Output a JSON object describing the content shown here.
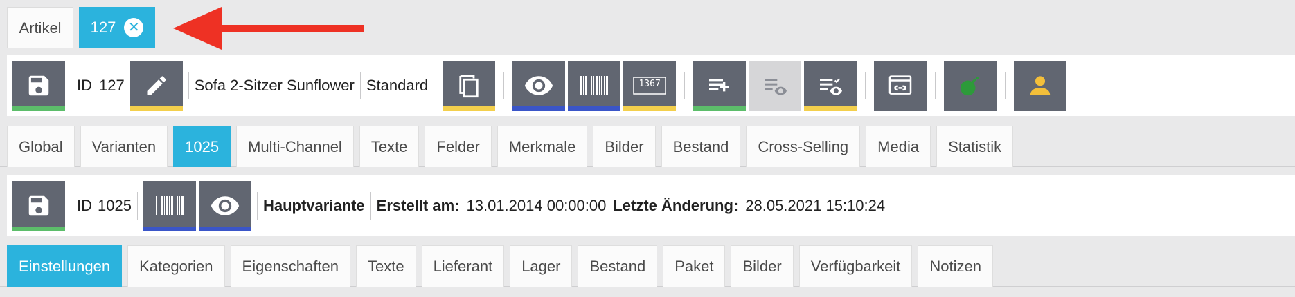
{
  "top_tabs": {
    "artikel": "Artikel",
    "active": "127"
  },
  "toolbar1": {
    "id_label": "ID",
    "id_value": "127",
    "name": "Sofa 2-Sitzer Sunflower",
    "variant_type": "Standard"
  },
  "tabs1": [
    {
      "label": "Global"
    },
    {
      "label": "Varianten"
    },
    {
      "label": "1025"
    },
    {
      "label": "Multi-Channel"
    },
    {
      "label": "Texte"
    },
    {
      "label": "Felder"
    },
    {
      "label": "Merkmale"
    },
    {
      "label": "Bilder"
    },
    {
      "label": "Bestand"
    },
    {
      "label": "Cross-Selling"
    },
    {
      "label": "Media"
    },
    {
      "label": "Statistik"
    }
  ],
  "toolbar2": {
    "id_label": "ID",
    "id_value": "1025",
    "main_variant": "Hauptvariante",
    "created_label": "Erstellt am:",
    "created_value": "13.01.2014 00:00:00",
    "changed_label": "Letzte Änderung:",
    "changed_value": "28.05.2021 15:10:24"
  },
  "tabs2": [
    {
      "label": "Einstellungen"
    },
    {
      "label": "Kategorien"
    },
    {
      "label": "Eigenschaften"
    },
    {
      "label": "Texte"
    },
    {
      "label": "Lieferant"
    },
    {
      "label": "Lager"
    },
    {
      "label": "Bestand"
    },
    {
      "label": "Paket"
    },
    {
      "label": "Bilder"
    },
    {
      "label": "Verfügbarkeit"
    },
    {
      "label": "Notizen"
    }
  ],
  "icons": {
    "barcode_number": "1367"
  },
  "colors": {
    "accent": "#2bb3dd",
    "button": "#616671",
    "green": "#5cbd6a",
    "yellow": "#f3cf4c",
    "blue": "#3a55c8",
    "arrow": "#ee3124",
    "user": "#f3bf3a",
    "bomb": "#2d9a3a"
  }
}
